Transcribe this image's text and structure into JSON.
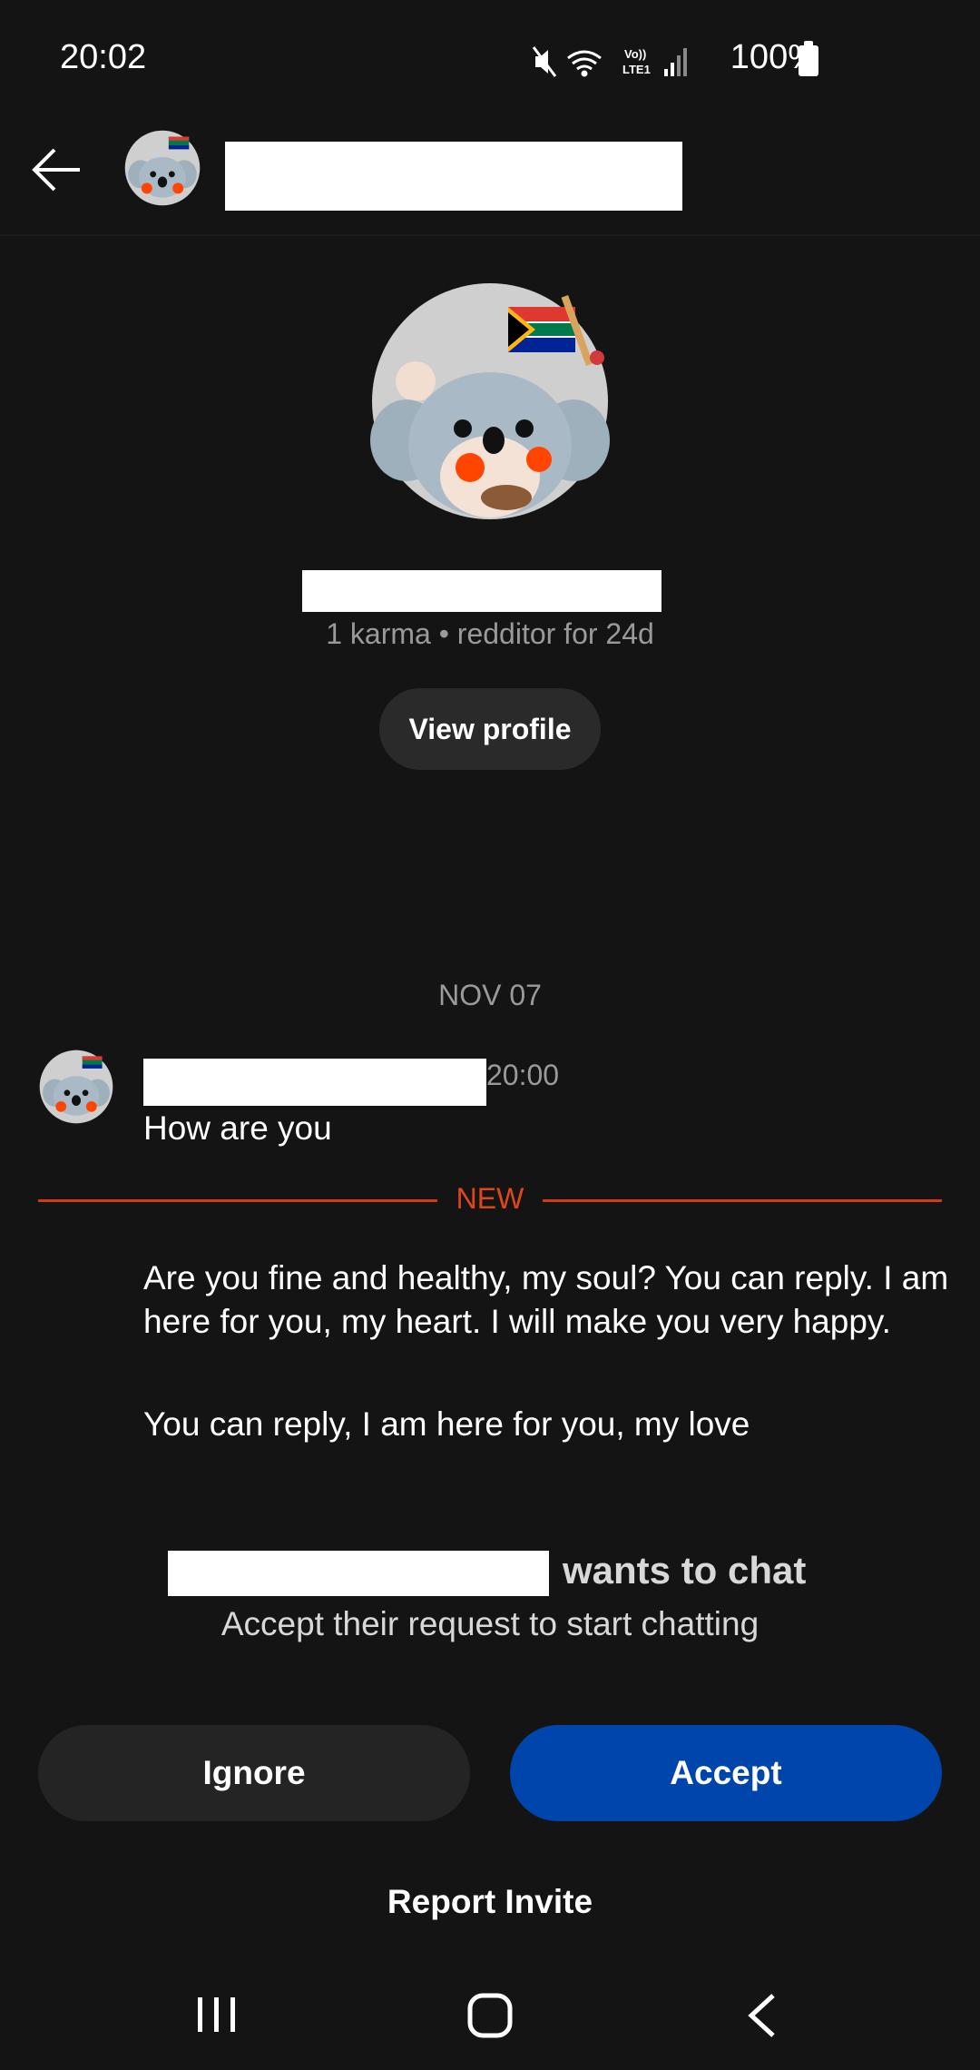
{
  "status_bar": {
    "time": "20:02",
    "battery": "100%",
    "icons": [
      "mute-icon",
      "wifi-icon",
      "volte-icon",
      "signal-icon",
      "battery-icon"
    ]
  },
  "header": {
    "back_icon": "back-arrow-icon"
  },
  "profile": {
    "meta": "1 karma • redditor for 24d",
    "view_profile_label": "View profile"
  },
  "conversation": {
    "date": "NOV 07",
    "first_message": {
      "time": "20:00",
      "text": "How are you"
    },
    "new_divider": "NEW",
    "messages": [
      "Are you fine and healthy, my soul? You can reply. I am here for you, my heart. I will make you very happy.",
      "You can reply, I am here for you, my love"
    ]
  },
  "request": {
    "title": "wants to chat",
    "subtitle": "Accept their request to start chatting",
    "ignore_label": "Ignore",
    "accept_label": "Accept",
    "report_label": "Report Invite"
  },
  "colors": {
    "background": "#141414",
    "accent_new": "#d13a13",
    "accept_button": "#0045ac",
    "secondary_button": "#242424"
  },
  "nav_bar": {
    "icons": [
      "recent-apps-icon",
      "home-icon",
      "nav-back-icon"
    ]
  }
}
